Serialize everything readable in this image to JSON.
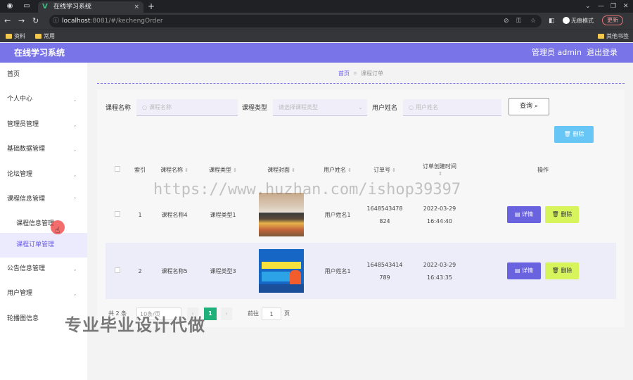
{
  "browser": {
    "tab_title": "在线学习系统",
    "url_host": "localhost",
    "url_path": ":8081/#/kechengOrder",
    "incognito_label": "无痕模式",
    "update_label": "更新",
    "bookmarks": [
      "资料",
      "常用"
    ],
    "other_bookmarks": "其他书签"
  },
  "header": {
    "title": "在线学习系统",
    "user": "管理员 admin",
    "logout": "退出登录"
  },
  "sidebar": {
    "items": [
      {
        "label": "首页"
      },
      {
        "label": "个人中心"
      },
      {
        "label": "管理员管理"
      },
      {
        "label": "基础数据管理"
      },
      {
        "label": "论坛管理"
      },
      {
        "label": "课程信息管理"
      },
      {
        "label": "课程信息管理"
      },
      {
        "label": "课程订单管理"
      },
      {
        "label": "公告信息管理"
      },
      {
        "label": "用户管理"
      },
      {
        "label": "轮播图信息"
      }
    ]
  },
  "breadcrumb": {
    "home": "首页",
    "current": "课程订单"
  },
  "filters": {
    "course_name_label": "课程名称",
    "course_name_placeholder": "课程名称",
    "course_type_label": "课程类型",
    "course_type_placeholder": "请选择课程类型",
    "user_name_label": "用户姓名",
    "user_name_placeholder": "用户姓名",
    "query_label": "查询",
    "delete_label": "删除"
  },
  "table": {
    "headers": [
      "索引",
      "课程名称",
      "课程类型",
      "课程封面",
      "用户姓名",
      "订单号",
      "订单创建时间",
      "操作"
    ],
    "rows": [
      {
        "index": "1",
        "course_name": "课程名称4",
        "course_type": "课程类型1",
        "user_name": "用户姓名1",
        "order_no_1": "1648543478",
        "order_no_2": "824",
        "date": "2022-03-29",
        "time": "16:44:40"
      },
      {
        "index": "2",
        "course_name": "课程名称5",
        "course_type": "课程类型3",
        "user_name": "用户姓名1",
        "order_no_1": "1648543414",
        "order_no_2": "789",
        "date": "2022-03-29",
        "time": "16:43:35"
      }
    ],
    "detail_label": "详情",
    "delete_label": "删除"
  },
  "pager": {
    "total": "共 2 条",
    "page_size": "10条/页",
    "current_page": "1",
    "goto_label": "前往",
    "goto_value": "1",
    "page_unit": "页"
  },
  "overlay": {
    "watermark": "https://www.huzhan.com/ishop39397",
    "stamp": "专业毕业设计代做"
  },
  "colors": {
    "header": "#7a74e9",
    "accent": "#6a5fe8",
    "detail_button": "#6a63e0",
    "delete_button": "#d7f45c",
    "top_delete_button": "#67c6f5",
    "current_page": "#20b07a"
  }
}
